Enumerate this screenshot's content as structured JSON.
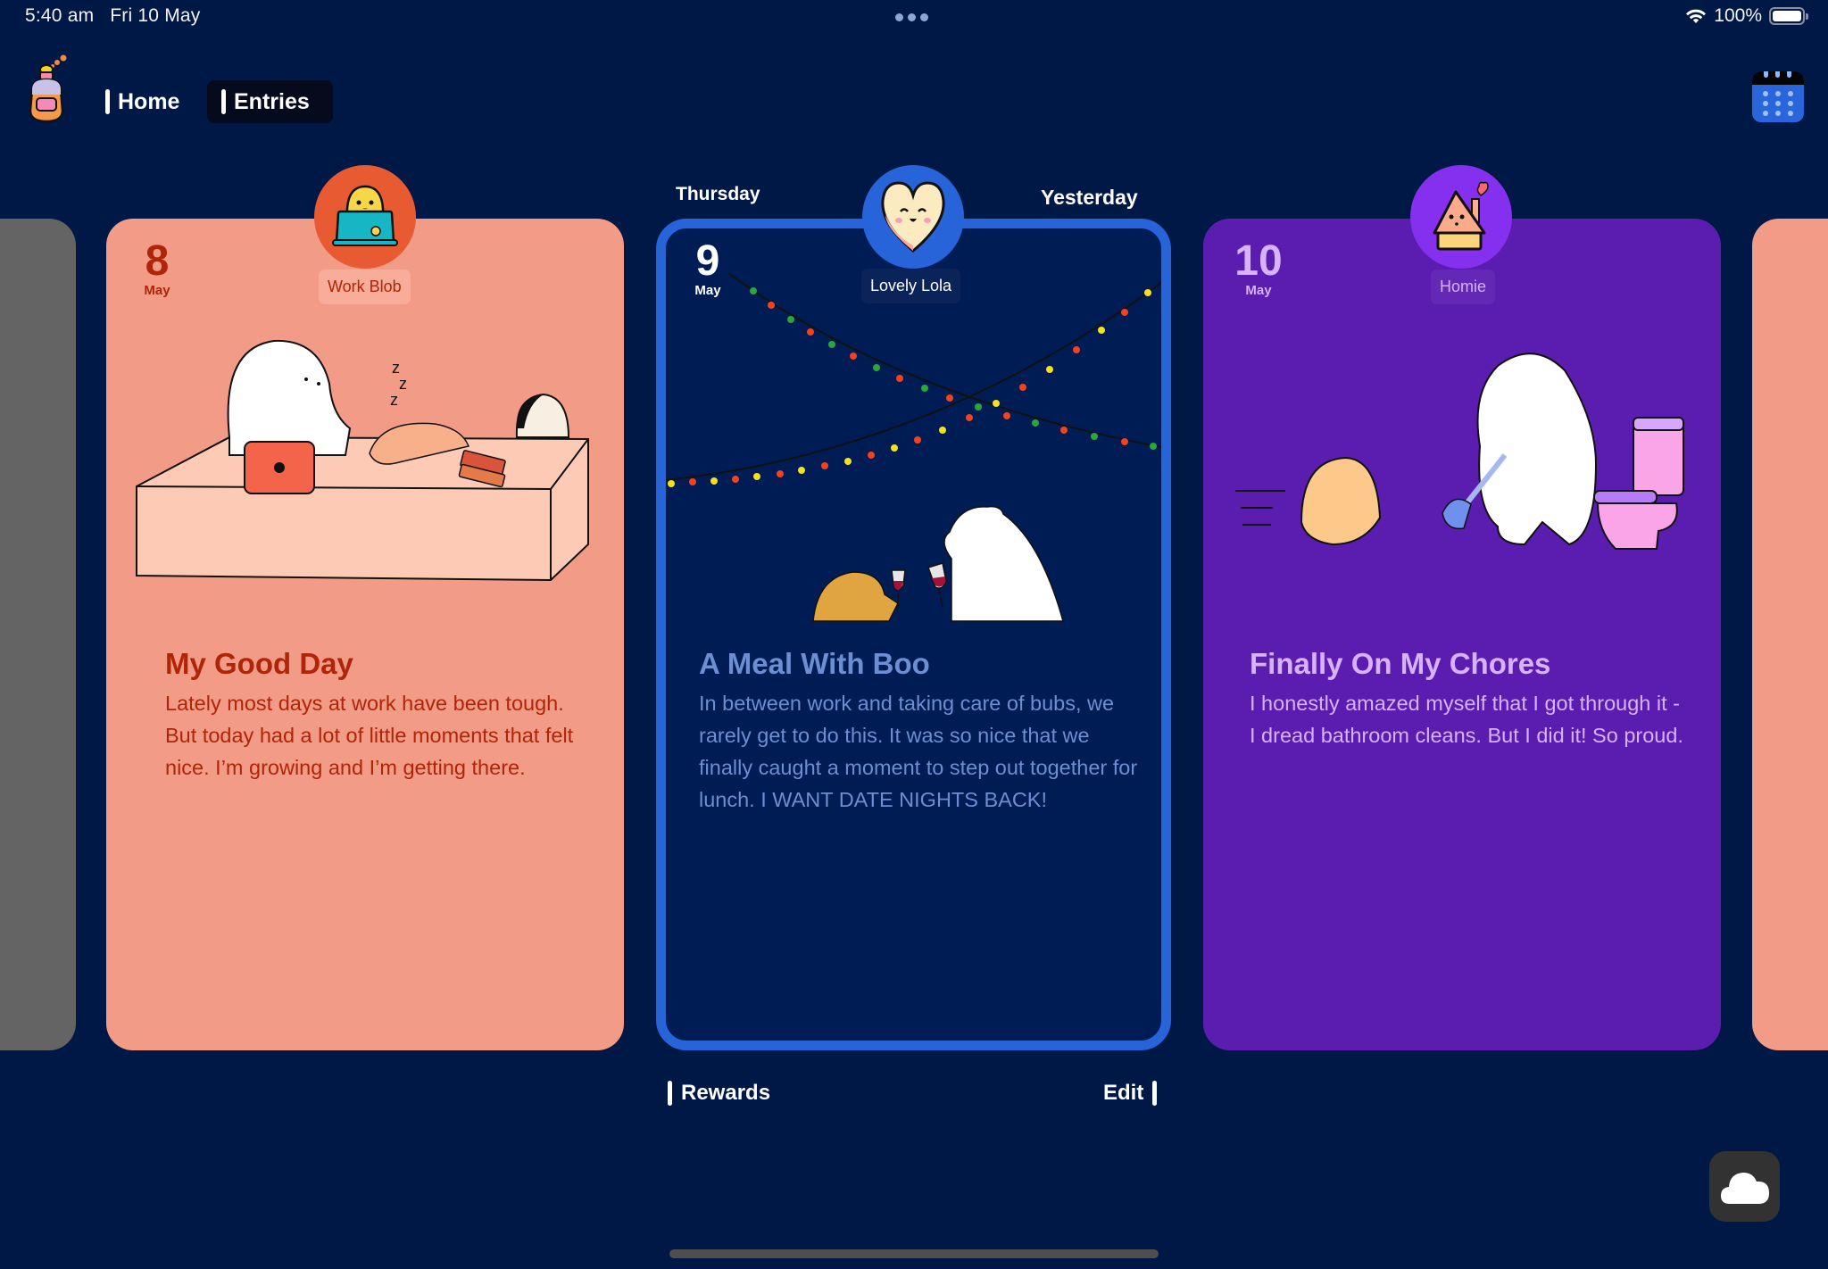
{
  "status_bar": {
    "time": "5:40 am",
    "date": "Fri 10 May",
    "battery": "100%",
    "battery_level": 1.0,
    "icons": [
      "wifi-icon",
      "battery-icon",
      "multitask-dots-icon"
    ]
  },
  "nav": {
    "logo": "perfume-bottle-logo",
    "tabs": [
      {
        "label": "Home",
        "active": false
      },
      {
        "label": "Entries",
        "active": true
      }
    ],
    "calendar_icon": "calendar-icon"
  },
  "carousel": {
    "prev_day_label": "Thursday",
    "next_day_label": "Yesterday",
    "entries": [
      {
        "day": "8",
        "month": "May",
        "mood": "Work Blob",
        "mood_icon": "blob-with-laptop-icon",
        "title": "My Good Day",
        "body": "Lately most days at work have been tough. But today had a lot of little moments that felt nice. I’m growing and I’m getting there.",
        "illustration": "bear-laptop-desk-illustration",
        "colors": {
          "card": "#f29c88",
          "accent": "#b02408",
          "avatar": "#e85a32"
        }
      },
      {
        "day": "9",
        "month": "May",
        "mood": "Lovely Lola",
        "mood_icon": "smiling-heart-icon",
        "title": "A Meal With Boo",
        "body": "In between work and taking care of bubs, we rarely get to do this. It was so nice that we finally caught a moment to step out together for lunch. I WANT DATE NIGHTS BACK!",
        "illustration": "bear-hedgehog-toast-illustration",
        "selected": true,
        "colors": {
          "card": "#001c55",
          "accent": "#6b8fd1",
          "avatar": "#2764d9",
          "border": "#2764d9"
        }
      },
      {
        "day": "10",
        "month": "May",
        "mood": "Homie",
        "mood_icon": "house-with-heart-icon",
        "title": "Finally On My Chores",
        "body": "I honestly amazed myself that I got through it - I dread bathroom cleans. But I did it! So proud.",
        "illustration": "bear-plunger-toilet-illustration",
        "colors": {
          "card": "#5a1db0",
          "accent": "#d8b1ff",
          "avatar": "#8530ee"
        }
      }
    ]
  },
  "footer": {
    "rewards_label": "Rewards",
    "edit_label": "Edit"
  },
  "cloud_button": "cloud-icon"
}
